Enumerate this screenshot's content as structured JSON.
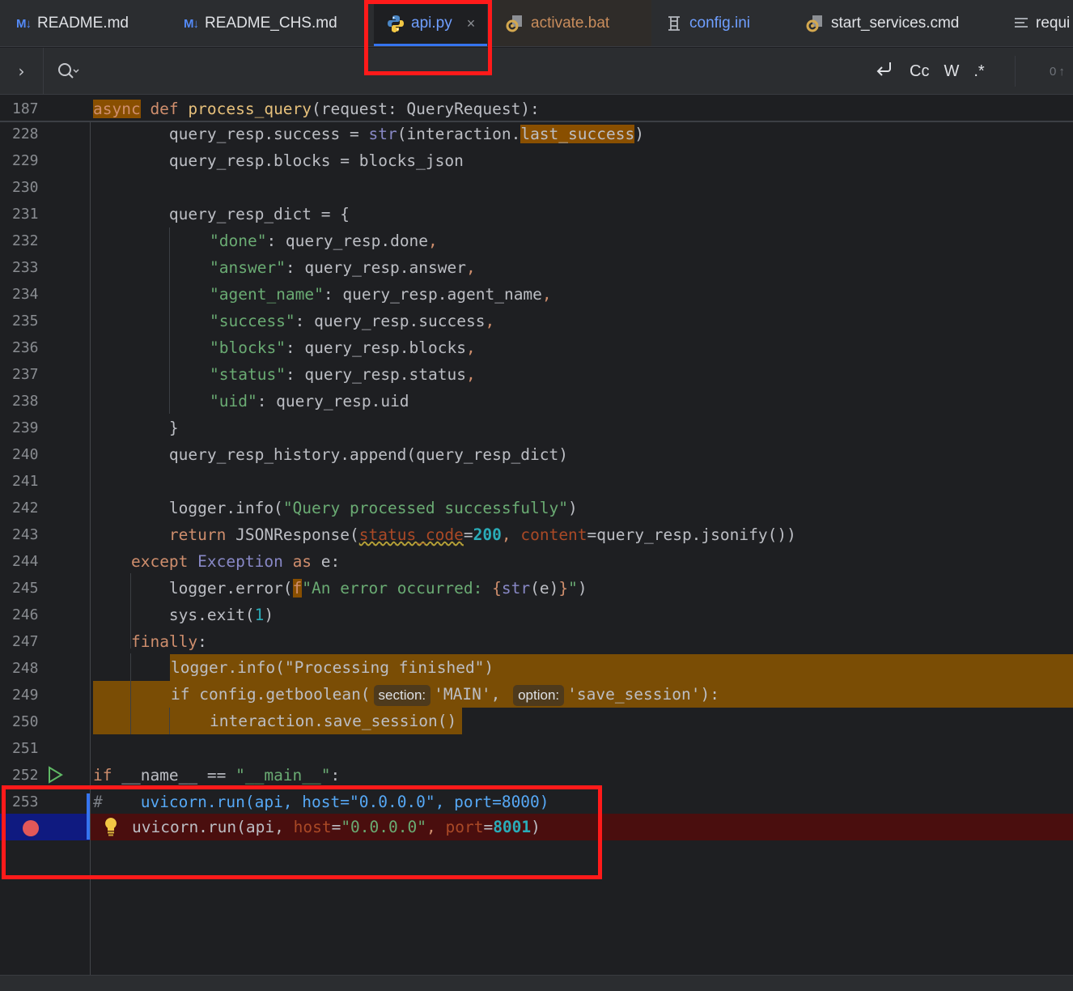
{
  "tabs": [
    {
      "label": "README.md",
      "icon": "markdown-icon",
      "icon_text": "M↓"
    },
    {
      "label": "README_CHS.md",
      "icon": "markdown-icon",
      "icon_text": "M↓"
    },
    {
      "label": "api.py",
      "icon": "python-icon",
      "active": true
    },
    {
      "label": "activate.bat",
      "icon": "batch-gear-icon"
    },
    {
      "label": "config.ini",
      "icon": "ini-config-icon"
    },
    {
      "label": "start_services.cmd",
      "icon": "cmd-gear-icon"
    },
    {
      "label": "requi",
      "icon": "text-file-icon"
    }
  ],
  "close_glyph": "×",
  "findbar": {
    "expand_glyph": "›",
    "options": [
      "Cc",
      "W",
      ".*"
    ],
    "match_count": "0"
  },
  "sticky": {
    "line": "187"
  },
  "lines": {
    "l228": "228",
    "l229": "229",
    "l230": "230",
    "l231": "231",
    "l232": "232",
    "l233": "233",
    "l234": "234",
    "l235": "235",
    "l236": "236",
    "l237": "237",
    "l238": "238",
    "l239": "239",
    "l240": "240",
    "l241": "241",
    "l242": "242",
    "l243": "243",
    "l244": "244",
    "l245": "245",
    "l246": "246",
    "l247": "247",
    "l248": "248",
    "l249": "249",
    "l250": "250",
    "l251": "251",
    "l252": "252",
    "l253": "253"
  },
  "code": {
    "sticky_async": "async",
    "sticky_def": " def ",
    "sticky_fn": "process_query",
    "sticky_rest": "(request: QueryRequest):",
    "c228a": "        query_resp.success = ",
    "c228b": "str",
    "c228c": "(interaction.",
    "c228d": "last_success",
    "c228e": ")",
    "c229": "        query_resp.blocks = blocks_json",
    "c231": "        query_resp_dict = {",
    "c232k": "\"done\"",
    "c232v": ": query_resp.done",
    "c233k": "\"answer\"",
    "c233v": ": query_resp.answer",
    "c234k": "\"agent_name\"",
    "c234v": ": query_resp.agent_name",
    "c235k": "\"success\"",
    "c235v": ": query_resp.success",
    "c236k": "\"blocks\"",
    "c236v": ": query_resp.blocks",
    "c237k": "\"status\"",
    "c237v": ": query_resp.status",
    "c238k": "\"uid\"",
    "c238v": ": query_resp.uid",
    "comma": ",",
    "c239": "        }",
    "c240": "        query_resp_history.append(query_resp_dict)",
    "c242a": "        logger.info(",
    "c242b": "\"Query processed successfully\"",
    "c242c": ")",
    "c243a": "        ",
    "c243b": "return",
    "c243c": " JSONResponse(",
    "c243d": "status_code",
    "c243e": "=",
    "c243f": "200",
    "c243g": ", ",
    "c243h": "content",
    "c243i": "=query_resp.jsonify())",
    "c244a": "    ",
    "c244b": "except",
    "c244c": " Exception ",
    "c244d": "as",
    "c244e": " e:",
    "c245a": "        logger.error(",
    "c245b": "f",
    "c245c": "\"An error occurred: ",
    "c245d": "{",
    "c245e": "str",
    "c245f": "(e)",
    "c245g": "}",
    "c245h": "\"",
    "c245i": ")",
    "c246a": "        sys.exit(",
    "c246b": "1",
    "c246c": ")",
    "c247a": "    ",
    "c247b": "finally",
    "c247c": ":",
    "c248": "logger.info(\"Processing finished\")",
    "c249a": "if",
    "c249b": " config.getboolean(",
    "c249hint1": "section:",
    "c249c": "'MAIN'",
    "c249d": ", ",
    "c249hint2": "option:",
    "c249e": "'save_session'",
    "c249f": "):",
    "c250": "interaction.save_session()",
    "c252a": "if",
    "c252b": " __name__ == ",
    "c252c": "\"__main__\"",
    "c252d": ":",
    "c253a": "#",
    "c253b": "    uvicorn.run(api, host=\"0.0.0.0\", port=8000)",
    "c254a": "uvicorn.run(api, ",
    "c254b": "host",
    "c254c": "=",
    "c254d": "\"0.0.0.0\"",
    "c254e": ", ",
    "c254f": "port",
    "c254g": "=",
    "c254h": "8001",
    "c254i": ")"
  },
  "colors": {
    "accent": "#3574f0",
    "breakpoint": "#e25858",
    "annotation_red": "#ff1a1a",
    "highlight_orange": "#7a4d05"
  }
}
